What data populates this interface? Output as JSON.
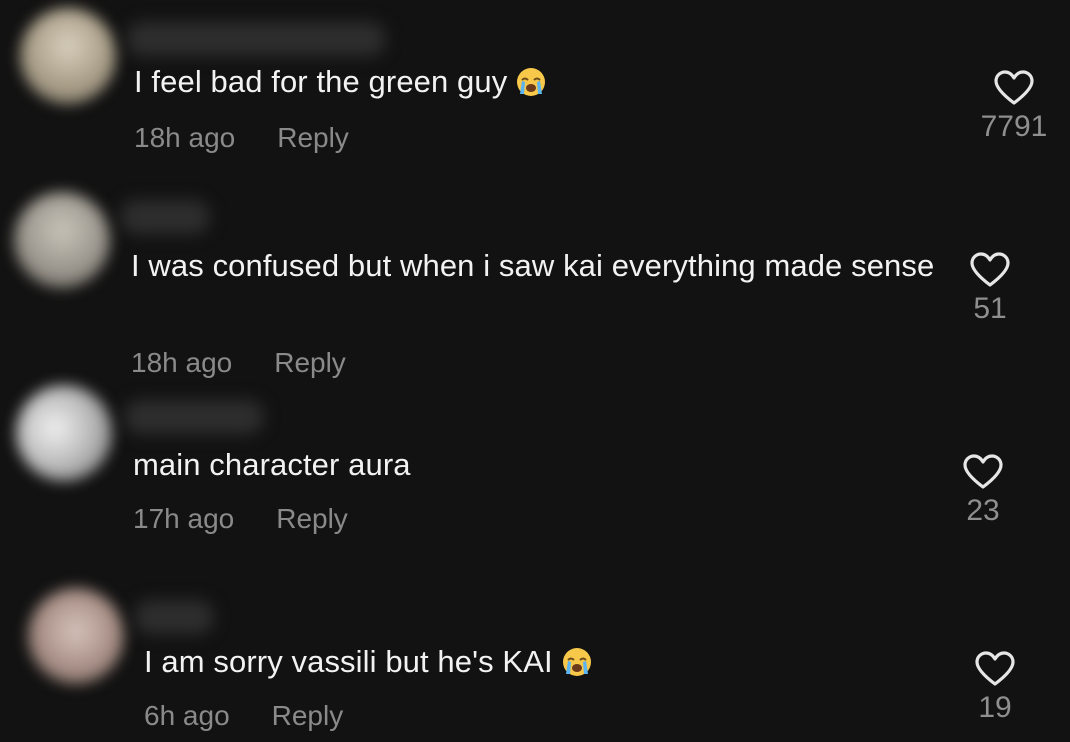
{
  "comments": [
    {
      "username": "user",
      "text": "I feel bad for the green guy",
      "emoji": "loudly-crying-face",
      "time": "18h ago",
      "reply_label": "Reply",
      "likes": "7791",
      "avatar_color": "#b7ad98"
    },
    {
      "username": "user",
      "text": "I was confused but when i saw kai everything made sense",
      "emoji": "",
      "time": "18h ago",
      "reply_label": "Reply",
      "likes": "51",
      "avatar_color": "#a8a39a"
    },
    {
      "username": "user",
      "text": "main character aura",
      "emoji": "",
      "time": "17h ago",
      "reply_label": "Reply",
      "likes": "23",
      "avatar_color": "#cfcfcf"
    },
    {
      "username": "user",
      "text": "I am sorry vassili but he's KAI",
      "emoji": "loudly-crying-face",
      "time": "6h ago",
      "reply_label": "Reply",
      "likes": "19",
      "avatar_color": "#b8a29c"
    }
  ],
  "colors": {
    "background": "#121212",
    "text": "#f2f2f2",
    "meta": "#8a8a8a"
  }
}
